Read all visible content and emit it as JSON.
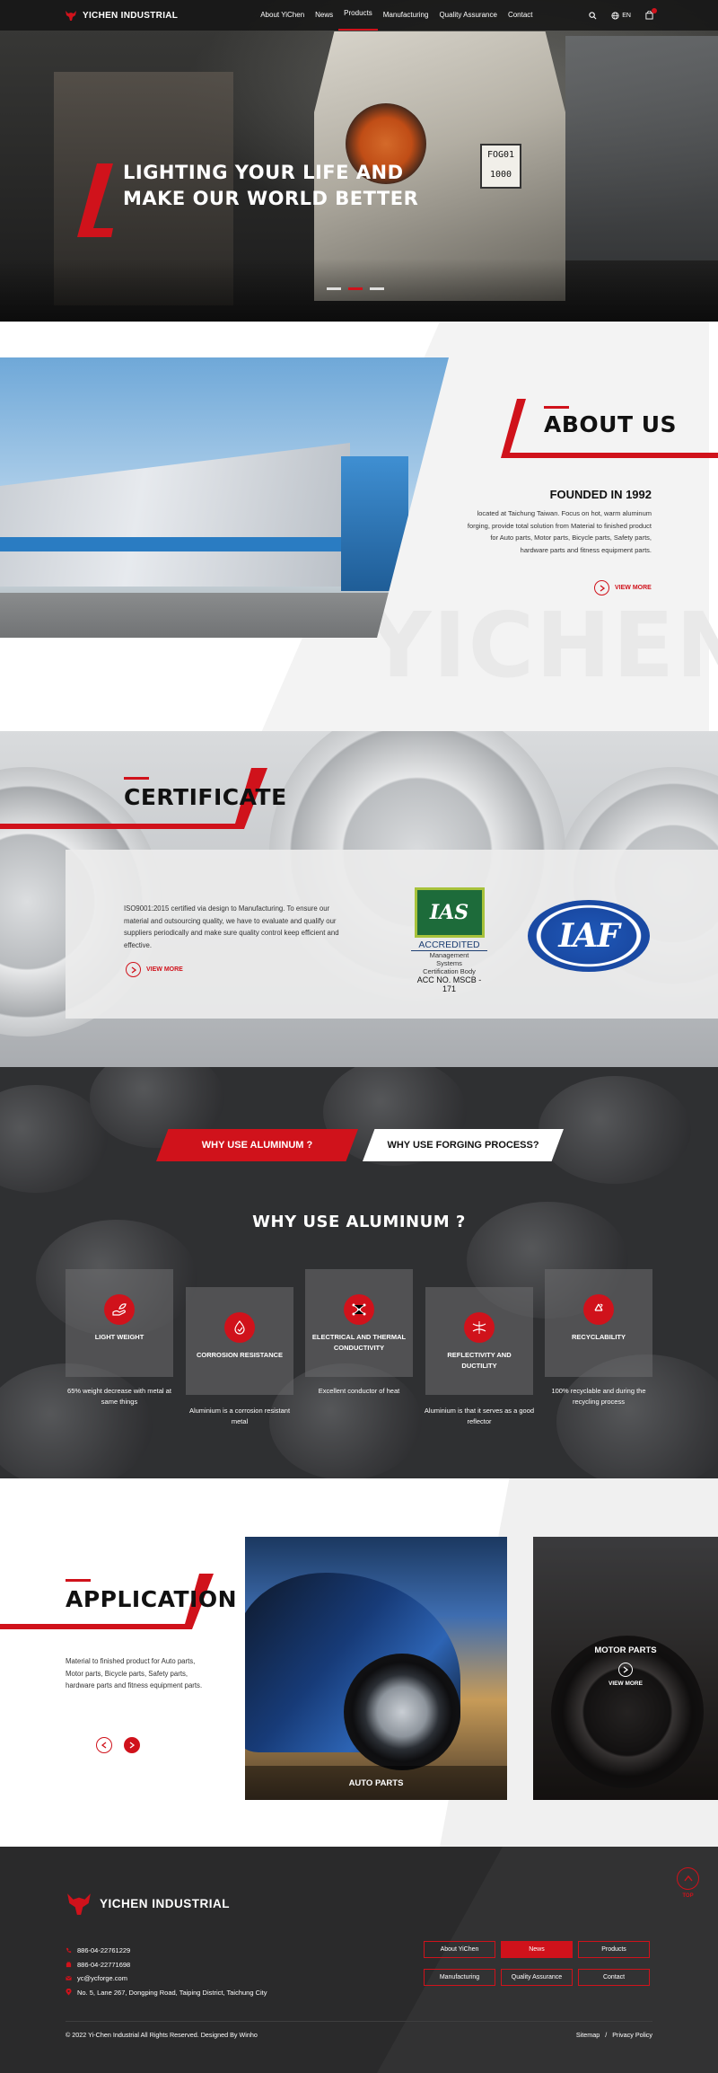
{
  "header": {
    "brand": "YICHEN INDUSTRIAL",
    "nav": [
      {
        "label": "About YiChen"
      },
      {
        "label": "News"
      },
      {
        "label": "Products"
      },
      {
        "label": "Manufacturing"
      },
      {
        "label": "Quality Assurance"
      },
      {
        "label": "Contact"
      }
    ],
    "active_nav": "Products",
    "language": "EN",
    "icons": [
      "search-icon",
      "globe-icon",
      "cart-icon"
    ]
  },
  "hero": {
    "title_line1": "LIGHTING YOUR LIFE AND",
    "title_line2": "MAKE OUR WORLD BETTER",
    "machine_plate_line1": "FOG01",
    "machine_plate_line2": "1000",
    "slides": 3,
    "active_slide": 1
  },
  "about": {
    "title": "ABOUT US",
    "subtitle": "FOUNDED IN 1992",
    "description": "located at Taichung Taiwan. Focus on hot, warm aluminum forging, provide total solution from Material to finished product for Auto parts, Motor parts, Bicycle parts, Safety parts, hardware parts and fitness equipment parts.",
    "more_label": "VIEW MORE",
    "watermark": "YICHEN"
  },
  "certificate": {
    "title": "CERTIFICATE",
    "description": "ISO9001:2015 certified via design to Manufacturing. To ensure our material and outsourcing quality, we have to evaluate and qualify our suppliers periodically and make sure quality control keep efficient and effective.",
    "more_label": "VIEW MORE",
    "ias": {
      "mark": "IAS",
      "accredited": "ACCREDITED",
      "line1": "Management",
      "line2": "Systems",
      "line3": "Certification Body",
      "acc_no": "ACC NO. MSCB - 171"
    },
    "iaf": {
      "mark": "IAF"
    }
  },
  "aluminum": {
    "tabs": [
      {
        "label": "WHY USE ALUMINUM ?"
      },
      {
        "label": "WHY USE FORGING PROCESS?"
      }
    ],
    "active_tab": 0,
    "heading": "WHY USE ALUMINUM ?",
    "features": [
      {
        "label": "LIGHT WEIGHT",
        "desc": "65% weight decrease with metal at same things",
        "icon": "hand-leaf-icon"
      },
      {
        "label": "CORROSION RESISTANCE",
        "desc": "Aluminium is a corrosion resistant metal",
        "icon": "droplet-shield-icon"
      },
      {
        "label": "ELECTRICAL AND THERMAL CONDUCTIVITY",
        "desc": "Excellent conductor of heat",
        "icon": "network-icon"
      },
      {
        "label": "REFLECTIVITY AND DUCTILITY",
        "desc": "Aluminium is that it serves as a good reflector",
        "icon": "reflect-icon"
      },
      {
        "label": "RECYCLABILITY",
        "desc": "100% recyclable and during the recycling process",
        "icon": "recycle-icon"
      }
    ]
  },
  "application": {
    "title": "APPLICATION",
    "description": "Material to finished product for Auto parts, Motor parts, Bicycle parts, Safety parts, hardware parts and fitness equipment parts.",
    "cards": [
      {
        "label": "AUTO PARTS"
      },
      {
        "label": "MOTOR PARTS",
        "more": "VIEW MORE"
      }
    ]
  },
  "footer": {
    "brand": "YICHEN INDUSTRIAL",
    "phone1": "886-04-22761229",
    "phone2": "886-04-22771698",
    "email": "yc@ycforge.com",
    "address": "No. 5, Lane 267, Dongping Road, Taiping District, Taichung City",
    "nav": [
      {
        "label": "About YiChen"
      },
      {
        "label": "News"
      },
      {
        "label": "Products"
      },
      {
        "label": "Manufacturing"
      },
      {
        "label": "Quality Assurance"
      },
      {
        "label": "Contact"
      }
    ],
    "active_nav": "News",
    "top_label": "TOP",
    "copyright": "© 2022 Yi-Chen Industrial All Rights Reserved. Designed By Winho",
    "sitemap": "Sitemap",
    "separator": "/",
    "privacy": "Privacy Policy"
  },
  "colors": {
    "accent": "#d0121b",
    "dark": "#2a2a2b"
  }
}
